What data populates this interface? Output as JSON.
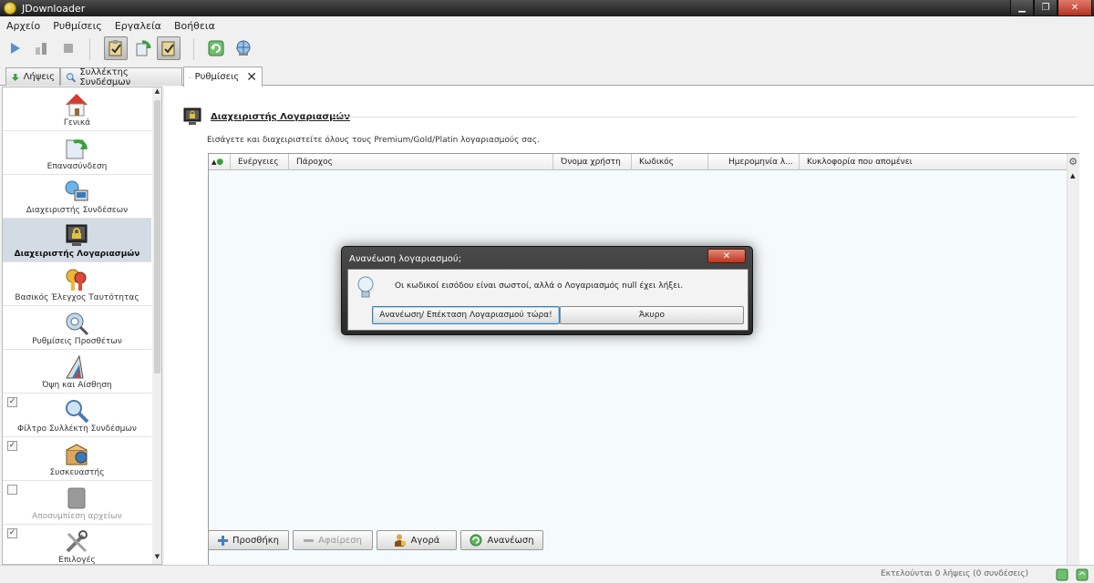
{
  "window": {
    "title": "JDownloader"
  },
  "menu": [
    "Αρχείο",
    "Ρυθμίσεις",
    "Εργαλεία",
    "Βοήθεια"
  ],
  "tabs": [
    {
      "label": "Λήψεις"
    },
    {
      "label": "Συλλέκτης Συνδέσμων"
    },
    {
      "label": "Ρυθμίσεις",
      "active": true
    }
  ],
  "sidebar": {
    "items": [
      {
        "label": "Γενικά",
        "icon": "home-icon"
      },
      {
        "label": "Επανασύνδεση",
        "icon": "reconnect-icon"
      },
      {
        "label": "Διαχειριστής Συνδέσεων",
        "icon": "connection-manager-icon"
      },
      {
        "label": "Διαχειριστής Λογαριασμών",
        "icon": "account-manager-icon",
        "selected": true
      },
      {
        "label": "Βασικός Έλεγχος Ταυτότητας",
        "icon": "keys-icon"
      },
      {
        "label": "Ρυθμίσεις Προσθέτων",
        "icon": "plugin-settings-icon"
      },
      {
        "label": "Όψη και Αίσθηση",
        "icon": "look-and-feel-icon"
      },
      {
        "label": "Φίλτρο Συλλέκτη Συνδέσμων",
        "icon": "linkgrabber-filter-icon",
        "checkbox": true,
        "checked": true
      },
      {
        "label": "Συσκευαστής",
        "icon": "packagizer-icon",
        "checkbox": true,
        "checked": true
      },
      {
        "label": "Αποσυμπίεση αρχείων",
        "icon": "archive-extraction-icon",
        "checkbox": true,
        "checked": false,
        "disabled": true
      },
      {
        "label": "Επιλογές",
        "icon": "tools-icon",
        "checkbox": true,
        "checked": true
      }
    ]
  },
  "main": {
    "title": "Διαχειριστής Λογαριασμών",
    "description": "Εισάγετε και διαχειριστείτε όλους τους Premium/Gold/Platin λογαριασμούς σας.",
    "columns": [
      "Ενέργειες",
      "Πάροχος",
      "Όνομα χρήστη",
      "Κωδικός",
      "Ημερομηνία λ...",
      "Κυκλοφορία που απομένει"
    ],
    "buttons": {
      "add": "Προσθήκη",
      "remove": "Αφαίρεση",
      "buy": "Αγορά",
      "refresh": "Ανανέωση"
    }
  },
  "status": {
    "text": "Εκτελούνται 0 λήψεις (0 συνδέσεις)"
  },
  "dialog": {
    "title": "Ανανέωση λογαριασμού;",
    "message": "Οι κωδικοί εισόδου είναι σωστοί, αλλά ο Λογαριασμός null έχει λήξει.",
    "confirm": "Ανανέωση/ Επέκταση Λογαριασμού τώρα!",
    "cancel": "Άκυρο"
  }
}
